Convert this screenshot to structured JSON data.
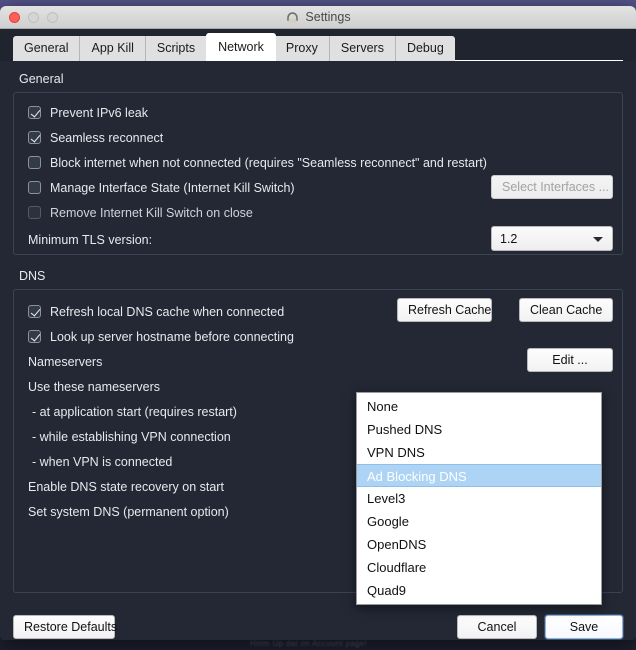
{
  "window": {
    "title": "Settings",
    "app_icon": "padlock-icon",
    "traffic_lights": [
      "close",
      "minimize",
      "zoom"
    ]
  },
  "tabs": [
    {
      "label": "General",
      "active": false
    },
    {
      "label": "App Kill",
      "active": false
    },
    {
      "label": "Scripts",
      "active": false
    },
    {
      "label": "Network",
      "active": true
    },
    {
      "label": "Proxy",
      "active": false
    },
    {
      "label": "Servers",
      "active": false
    },
    {
      "label": "Debug",
      "active": false
    }
  ],
  "general": {
    "title": "General",
    "checkboxes": [
      {
        "label": "Prevent IPv6 leak",
        "checked": true,
        "enabled": true
      },
      {
        "label": "Seamless reconnect",
        "checked": true,
        "enabled": true
      },
      {
        "label": "Block internet when not connected (requires \"Seamless reconnect\" and restart)",
        "checked": false,
        "enabled": true
      },
      {
        "label": "Manage Interface State (Internet Kill Switch)",
        "checked": false,
        "enabled": true
      },
      {
        "label": "Remove Internet Kill Switch on close",
        "checked": false,
        "enabled": false
      }
    ],
    "select_interfaces_button": "Select Interfaces ...",
    "tls_label": "Minimum TLS version:",
    "tls_value": "1.2"
  },
  "dns": {
    "title": "DNS",
    "checkboxes": [
      {
        "label": "Refresh local DNS cache when connected",
        "checked": true
      },
      {
        "label": "Look up server hostname before connecting",
        "checked": true
      }
    ],
    "refresh_cache_button": "Refresh Cache",
    "clean_cache_button": "Clean Cache",
    "nameservers_label": "Nameservers",
    "edit_button": "Edit ...",
    "use_these_nameservers_label": "Use these nameservers",
    "rows": [
      "- at application start (requires restart)",
      "- while establishing VPN connection",
      "- when VPN is connected",
      "Enable DNS state recovery on start",
      "Set system DNS (permanent option)"
    ]
  },
  "dropdown": {
    "open": true,
    "selected": "Ad Blocking DNS",
    "items": [
      "None",
      "Pushed DNS",
      "VPN DNS",
      "Ad Blocking DNS",
      "Level3",
      "Google",
      "OpenDNS",
      "Cloudflare",
      "Quad9"
    ]
  },
  "footer": {
    "restore_defaults_button": "Restore Defaults",
    "cancel_button": "Cancel",
    "save_button": "Save"
  },
  "background": {
    "ghost_line": "Hmm Up dat on Account page!"
  },
  "colors": {
    "window_bg": "#232834",
    "accent_selection": "#aed4f5",
    "tab_active": "#ffffff",
    "close_light": "#ff5f57"
  }
}
